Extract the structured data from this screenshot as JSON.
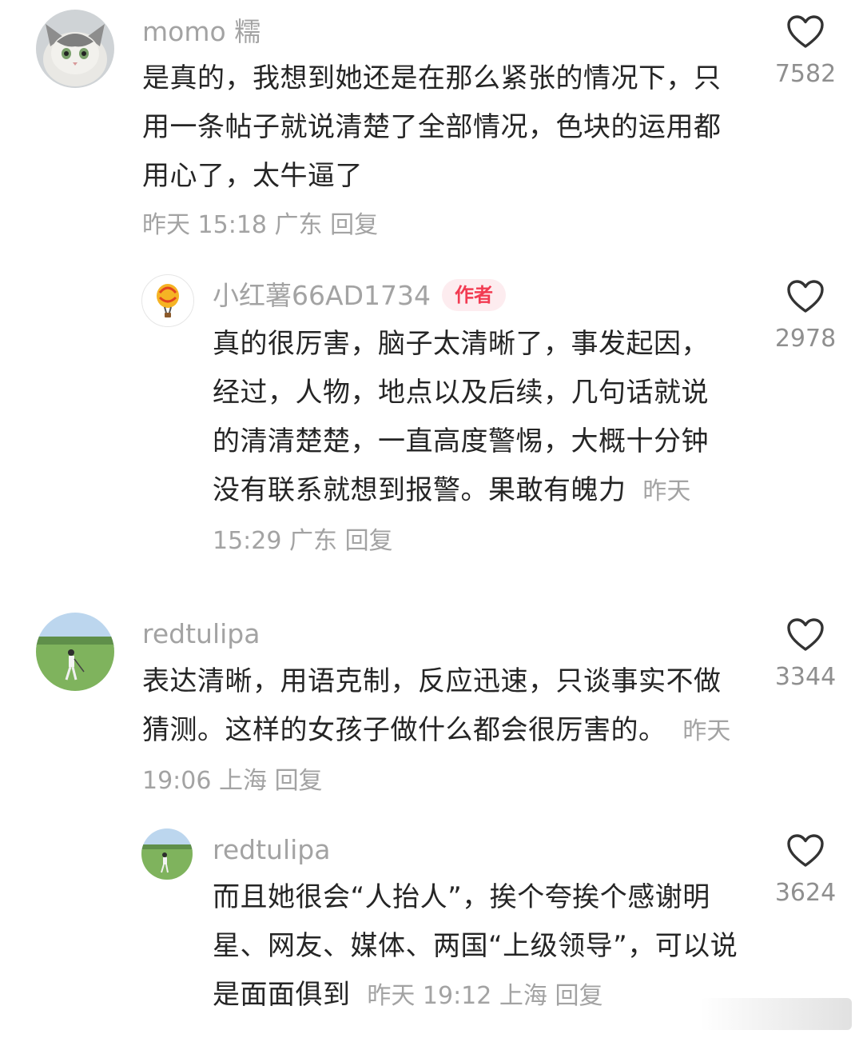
{
  "comments": [
    {
      "username": "momo 糯",
      "text": "是真的，我想到她还是在那么紧张的情况下，只用一条帖子就说清楚了全部情况，色块的运用都用心了，太牛逼了",
      "time": "昨天 15:18",
      "location": "广东",
      "reply_label": "回复",
      "likes": "7582",
      "avatar_icon": "cat-avatar"
    },
    {
      "username": "小红薯66AD1734",
      "badge": "作者",
      "text": "真的很厉害，脑子太清晰了，事发起因，经过，人物，地点以及后续，几句话就说的清清楚楚，一直高度警惕，大概十分钟没有联系就想到报警。果敢有魄力",
      "time": "昨天 15:29",
      "location": "广东",
      "reply_label": "回复",
      "likes": "2978",
      "avatar_icon": "balloon-avatar"
    },
    {
      "username": "redtulipa",
      "text": "表达清晰，用语克制，反应迅速，只谈事实不做猜测。这样的女孩子做什么都会很厉害的。",
      "time": "昨天 19:06",
      "location": "上海",
      "reply_label": "回复",
      "likes": "3344",
      "avatar_icon": "golf-avatar"
    },
    {
      "username": "redtulipa",
      "text": "而且她很会“人抬人”，挨个夸挨个感谢明星、网友、媒体、两国“上级领导”，可以说是面面俱到",
      "time": "昨天 19:12",
      "location": "上海",
      "reply_label": "回复",
      "likes": "3624",
      "avatar_icon": "golf-avatar"
    }
  ],
  "colors": {
    "meta_gray": "#a3a3a3",
    "text": "#252525",
    "author_badge_bg": "#fdecef",
    "author_badge_text": "#f23b52"
  }
}
